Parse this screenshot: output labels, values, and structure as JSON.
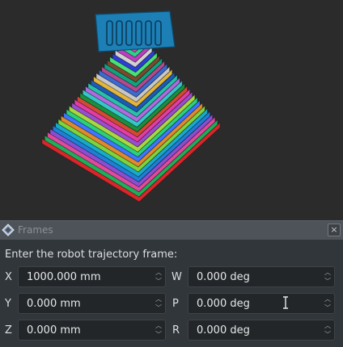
{
  "window": {
    "title": "Frames",
    "close_glyph": "×"
  },
  "prompt": "Enter the robot trajectory frame:",
  "fields": {
    "x": {
      "label": "X",
      "value": "1000.000 mm"
    },
    "y": {
      "label": "Y",
      "value": "0.000 mm"
    },
    "z": {
      "label": "Z",
      "value": "0.000 mm"
    },
    "w": {
      "label": "W",
      "value": "0.000 deg"
    },
    "p": {
      "label": "P",
      "value": "0.000 deg"
    },
    "r": {
      "label": "R",
      "value": "0.000 deg"
    }
  },
  "icons": {
    "logo": "app-logo-icon",
    "spin_up": "chevron-up-icon",
    "spin_down": "chevron-down-icon",
    "cursor": "text-cursor-icon"
  },
  "colors": {
    "viewport_bg": "#2b2b2c",
    "panel_bg": "#31363b",
    "titlebar_bg": "#4d5359",
    "field_bg": "#232629",
    "layers": [
      "#d9262b",
      "#1fae5a",
      "#e04a9c",
      "#8a4fd1",
      "#1f7ed6",
      "#19a9c9",
      "#7ed43a",
      "#e0892e",
      "#3d77ff",
      "#2dd07a",
      "#a8d840",
      "#9a4dd0",
      "#e23ea2",
      "#d24a34",
      "#1b8f3e",
      "#35c6c6",
      "#b06ae0",
      "#28c0a8",
      "#1d5bb8",
      "#e3b53a",
      "#c7c7c7",
      "#3b6bd0",
      "#b24a8e",
      "#0fa37e",
      "#7a4a2e",
      "#49e07a",
      "#2d3ed6",
      "#d1d1d1",
      "#c23bc2",
      "#2bd28c",
      "#d64ab0",
      "#1c7fb6"
    ],
    "top_block": "#1c7fb6"
  }
}
